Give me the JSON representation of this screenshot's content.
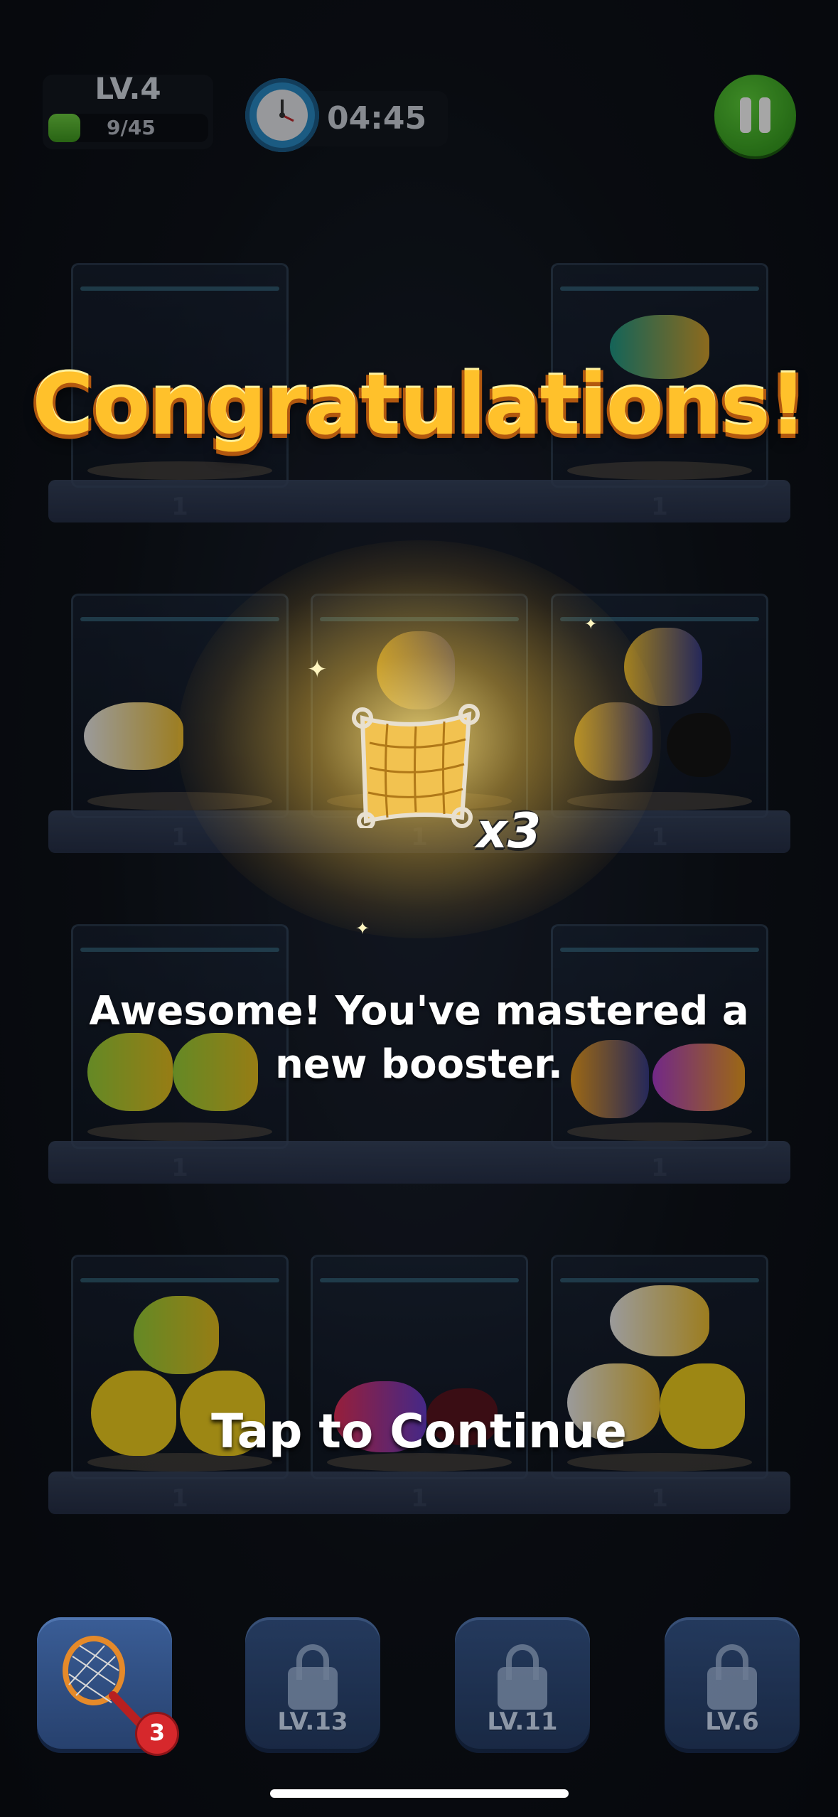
{
  "hud": {
    "level": "LV.4",
    "xp_text": "9/45",
    "xp_progress": 0.2,
    "timer": "04:45"
  },
  "overlay": {
    "title": "Congratulations!",
    "reward_multiplier": "x3",
    "message": "Awesome! You've mastered a new booster.",
    "continue_text": "Tap to Continue"
  },
  "tanks": {
    "label": "1"
  },
  "boosters": [
    {
      "icon": "net-booster-icon",
      "badge": "3",
      "locked": false
    },
    {
      "icon": "lock-icon",
      "label": "LV.13",
      "locked": true
    },
    {
      "icon": "lock-icon",
      "label": "LV.11",
      "locked": true
    },
    {
      "icon": "lock-icon",
      "label": "LV.6",
      "locked": true
    }
  ],
  "colors": {
    "title": "#ffc12b",
    "pause_button": "#3fae22",
    "badge": "#d6282c"
  }
}
